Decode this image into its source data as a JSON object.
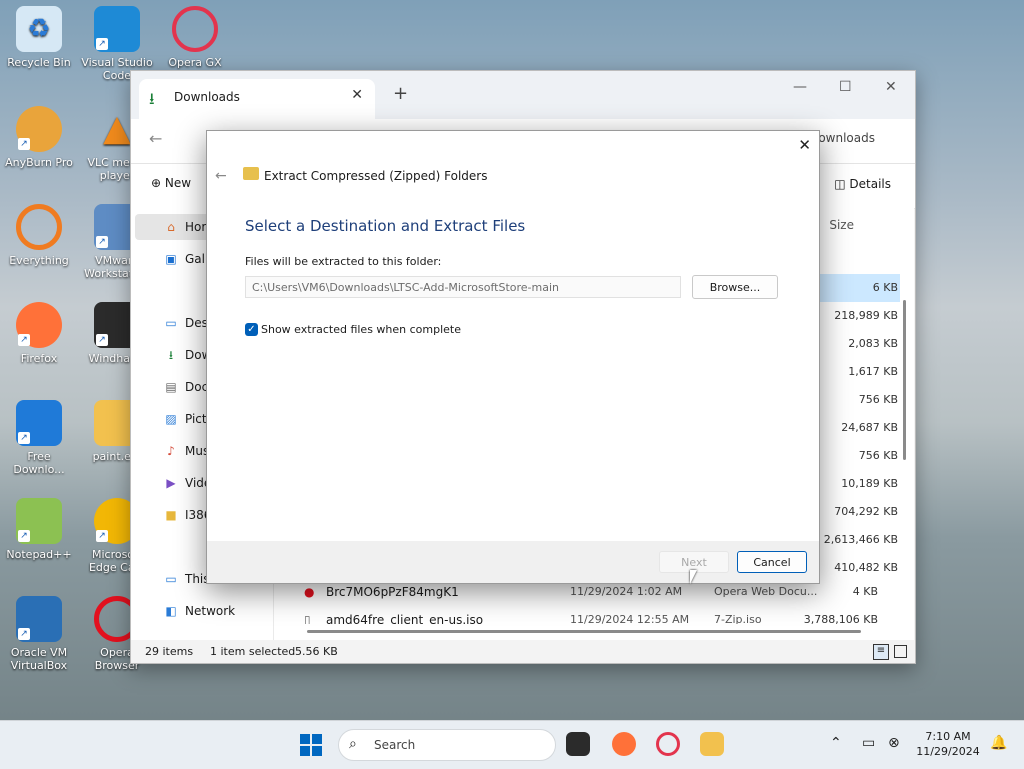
{
  "desktop_icons": [
    {
      "label": "Recycle Bin",
      "icon": "recycle-bin-icon",
      "color": "#d6e8f5"
    },
    {
      "label": "Visual Studio Code",
      "icon": "vscode-icon",
      "color": "#1e8ad6"
    },
    {
      "label": "Opera GX",
      "icon": "opera-gx-icon",
      "color": "#e3344d"
    },
    {
      "label": "AnyBurn Pro",
      "icon": "anyburn-icon",
      "color": "#e9a43b"
    },
    {
      "label": "VLC media player",
      "icon": "vlc-icon",
      "color": "#f08a1c"
    },
    {
      "label": "Everything",
      "icon": "everything-icon",
      "color": "#f07b20"
    },
    {
      "label": "VMware Workstation",
      "icon": "vmware-icon",
      "color": "#5e8cc4"
    },
    {
      "label": "Firefox",
      "icon": "firefox-icon",
      "color": "#ff7139"
    },
    {
      "label": "Windhawk",
      "icon": "windhawk-icon",
      "color": "#2b2b2b"
    },
    {
      "label": "Free Downlo...",
      "icon": "free-download-manager-icon",
      "color": "#1f7ad8"
    },
    {
      "label": "paint.e...",
      "icon": "folder-icon",
      "color": "#f2c14e"
    },
    {
      "label": "Notepad++",
      "icon": "notepadpp-icon",
      "color": "#8cc152"
    },
    {
      "label": "Microsoft Edge Ca...",
      "icon": "edge-canary-icon",
      "color": "#f2b705"
    },
    {
      "label": "Oracle VM VirtualBox",
      "icon": "virtualbox-icon",
      "color": "#2a6fb5"
    },
    {
      "label": "Opera Browser",
      "icon": "opera-icon",
      "color": "#e3101e"
    }
  ],
  "explorer": {
    "tab_label": "Downloads",
    "search_placeholder": "Search Downloads",
    "new_label": "New",
    "details_label": "Details",
    "size_header": "Size",
    "nav": [
      "Hor",
      "Gall",
      "Desl",
      "Dow",
      "Doc",
      "Pict",
      "Mus",
      "Vide",
      "I386",
      "This PC",
      "Network"
    ],
    "sizes": [
      "6 KB",
      "218,989 KB",
      "2,083 KB",
      "1,617 KB",
      "756 KB",
      "24,687 KB",
      "756 KB",
      "10,189 KB",
      "704,292 KB",
      "2,613,466 KB",
      "410,482 KB",
      "4 KB",
      "3,788,106 KB"
    ],
    "rows": [
      {
        "name": "Brc7MO6pPzF84mgK1",
        "date": "11/29/2024 1:02 AM",
        "type": "Opera Web Docu...",
        "size": "4 KB"
      },
      {
        "name": "amd64fre_client_en-us.iso",
        "date": "11/29/2024 12:55 AM",
        "type": "7-Zip.iso",
        "size": "3,788,106 KB"
      }
    ],
    "status": {
      "count": "29 items",
      "selected": "1 item selected",
      "selsize": "5.56 KB"
    }
  },
  "dialog": {
    "window_title": "Extract Compressed (Zipped) Folders",
    "heading": "Select a Destination and Extract Files",
    "path_label": "Files will be extracted to this folder:",
    "path_value": "C:\\Users\\VM6\\Downloads\\LTSC-Add-MicrosoftStore-main",
    "browse_label": "Browse...",
    "checkbox_label": "Show extracted files when complete",
    "checkbox_checked": true,
    "next_label": "Next",
    "cancel_label": "Cancel"
  },
  "taskbar": {
    "search_label": "Search",
    "time": "7:10 AM",
    "date": "11/29/2024"
  },
  "colors": {
    "accent": "#005fb8",
    "heading": "#1e3f7a"
  }
}
